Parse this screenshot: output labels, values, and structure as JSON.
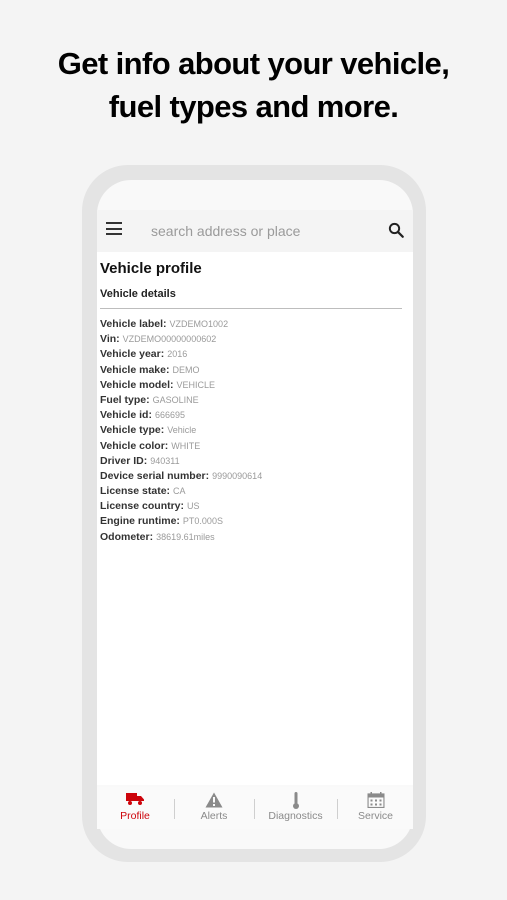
{
  "headline": {
    "line1": "Get info about your vehicle,",
    "line2": "fuel types and more."
  },
  "search": {
    "placeholder": "search address or place",
    "menu_icon": "hamburger-menu-icon",
    "search_icon": "magnifier-icon"
  },
  "profile": {
    "title": "Vehicle profile",
    "section": "Vehicle details",
    "details": [
      {
        "label": "Vehicle label:",
        "value": "VZDEMO1002"
      },
      {
        "label": "Vin:",
        "value": "VZDEMO00000000602"
      },
      {
        "label": "Vehicle year:",
        "value": "2016"
      },
      {
        "label": "Vehicle make:",
        "value": "DEMO"
      },
      {
        "label": "Vehicle model:",
        "value": "VEHICLE"
      },
      {
        "label": "Fuel type:",
        "value": "GASOLINE"
      },
      {
        "label": "Vehicle id:",
        "value": "666695"
      },
      {
        "label": "Vehicle type:",
        "value": "Vehicle"
      },
      {
        "label": "Vehicle color:",
        "value": "WHITE"
      },
      {
        "label": "Driver ID:",
        "value": "940311"
      },
      {
        "label": "Device serial number:",
        "value": "9990090614"
      },
      {
        "label": "License state:",
        "value": "CA"
      },
      {
        "label": "License country:",
        "value": "US"
      },
      {
        "label": "Engine runtime:",
        "value": "PT0.000S"
      },
      {
        "label": "Odometer:",
        "value": "38619.61miles"
      }
    ]
  },
  "tabs": [
    {
      "label": "Profile",
      "icon": "truck-icon",
      "active": true
    },
    {
      "label": "Alerts",
      "icon": "warning-triangle-icon",
      "active": false
    },
    {
      "label": "Diagnostics",
      "icon": "thermometer-icon",
      "active": false
    },
    {
      "label": "Service",
      "icon": "calendar-icon",
      "active": false
    }
  ],
  "colors": {
    "accent": "#cd040b",
    "inactive": "#8a8a8a"
  }
}
